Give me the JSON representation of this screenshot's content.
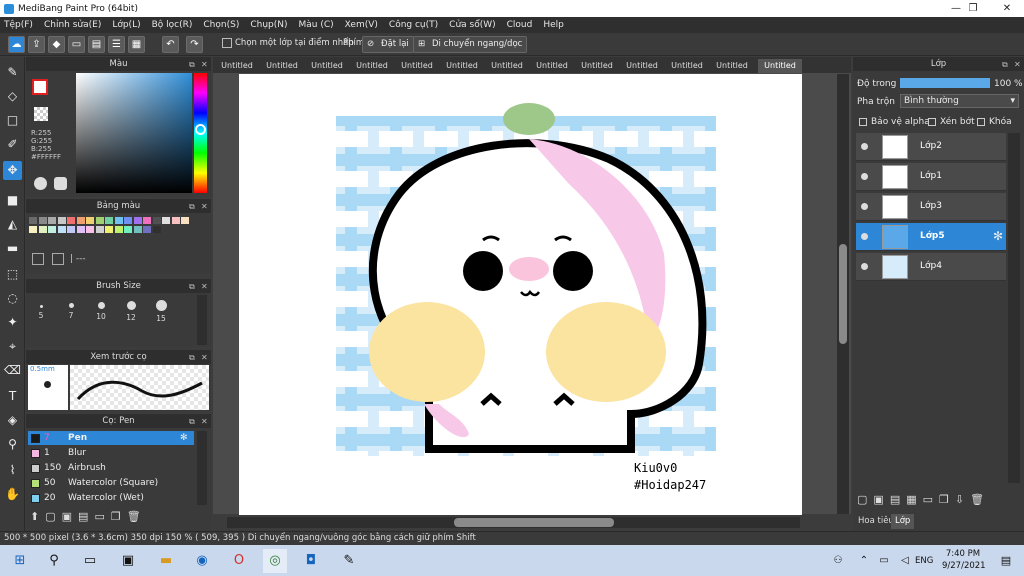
{
  "window": {
    "title": "MediBang Paint Pro (64bit)",
    "minimize": "—",
    "maximize": "❐",
    "close": "✕"
  },
  "menu": [
    "Tệp(F)",
    "Chỉnh sửa(E)",
    "Lớp(L)",
    "Bộ lọc(R)",
    "Chọn(S)",
    "Chụp(N)",
    "Màu (C)",
    "Xem(V)",
    "Công cụ(T)",
    "Cửa sổ(W)",
    "Cloud",
    "Help"
  ],
  "toolbar": {
    "select_layer_label": "Chọn một lớp tại điểm nhấp",
    "key_label": "Phím",
    "reset_label": "Đặt lại",
    "move_label": "Di chuyển ngang/dọc"
  },
  "color_panel": {
    "title": "Màu",
    "r": "R:255",
    "g": "G:255",
    "b": "B:255",
    "hex": "#FFFFFF"
  },
  "palette_panel": {
    "title": "Bảng màu",
    "extra": "| ---"
  },
  "brush_size_panel": {
    "title": "Brush Size",
    "sizes": [
      "5",
      "7",
      "10",
      "12",
      "15"
    ]
  },
  "preview_panel": {
    "title": "Xem trước cọ",
    "size": "0.5mm"
  },
  "brush_panel": {
    "title": "Cọ: Pen",
    "brushes": [
      {
        "size": "7",
        "name": "Pen",
        "color": "#1a1a1a",
        "selected": true
      },
      {
        "size": "1",
        "name": "Blur",
        "color": "#f3b6e0",
        "selected": false
      },
      {
        "size": "150",
        "name": "Airbrush",
        "color": "#cccccc",
        "selected": false
      },
      {
        "size": "50",
        "name": "Watercolor (Square)",
        "color": "#b5e07a",
        "selected": false
      },
      {
        "size": "20",
        "name": "Watercolor (Wet)",
        "color": "#7fd0ee",
        "selected": false
      }
    ]
  },
  "tabs": [
    "Untitled",
    "Untitled",
    "Untitled",
    "Untitled",
    "Untitled",
    "Untitled",
    "Untitled",
    "Untitled",
    "Untitled",
    "Untitled",
    "Untitled",
    "Untitled",
    "Untitled"
  ],
  "canvas": {
    "signature_line1": "Kiu0v0",
    "signature_line2": "#Hoidap247"
  },
  "layer_panel": {
    "title": "Lớp",
    "opacity_label": "Độ trong",
    "opacity_value": "100 %",
    "opacity_fraction": 1.0,
    "blend_label": "Pha trộn",
    "blend_value": "Bình thường",
    "protect_alpha": "Bảo vệ alpha",
    "clipping": "Xén bớt",
    "lock": "Khóa",
    "layers": [
      {
        "name": "Lớp2",
        "selected": false
      },
      {
        "name": "Lớp1",
        "selected": false
      },
      {
        "name": "Lớp3",
        "selected": false
      },
      {
        "name": "Lớp5",
        "selected": true
      },
      {
        "name": "Lớp4",
        "selected": false
      }
    ],
    "tab_navigator": "Hoa tiêu",
    "tab_layer": "Lớp"
  },
  "status": {
    "size": "500 * 500 pixel",
    "physical": "(3.6 * 3.6cm)",
    "dpi": "350 dpi",
    "zoom": "150 %",
    "coords": "( 509, 395 )",
    "hint": "Di chuyển ngang/vuông góc bằng cách giữ phím Shift"
  },
  "taskbar": {
    "time": "7:40 PM",
    "date": "9/27/2021",
    "lang": "ENG"
  }
}
